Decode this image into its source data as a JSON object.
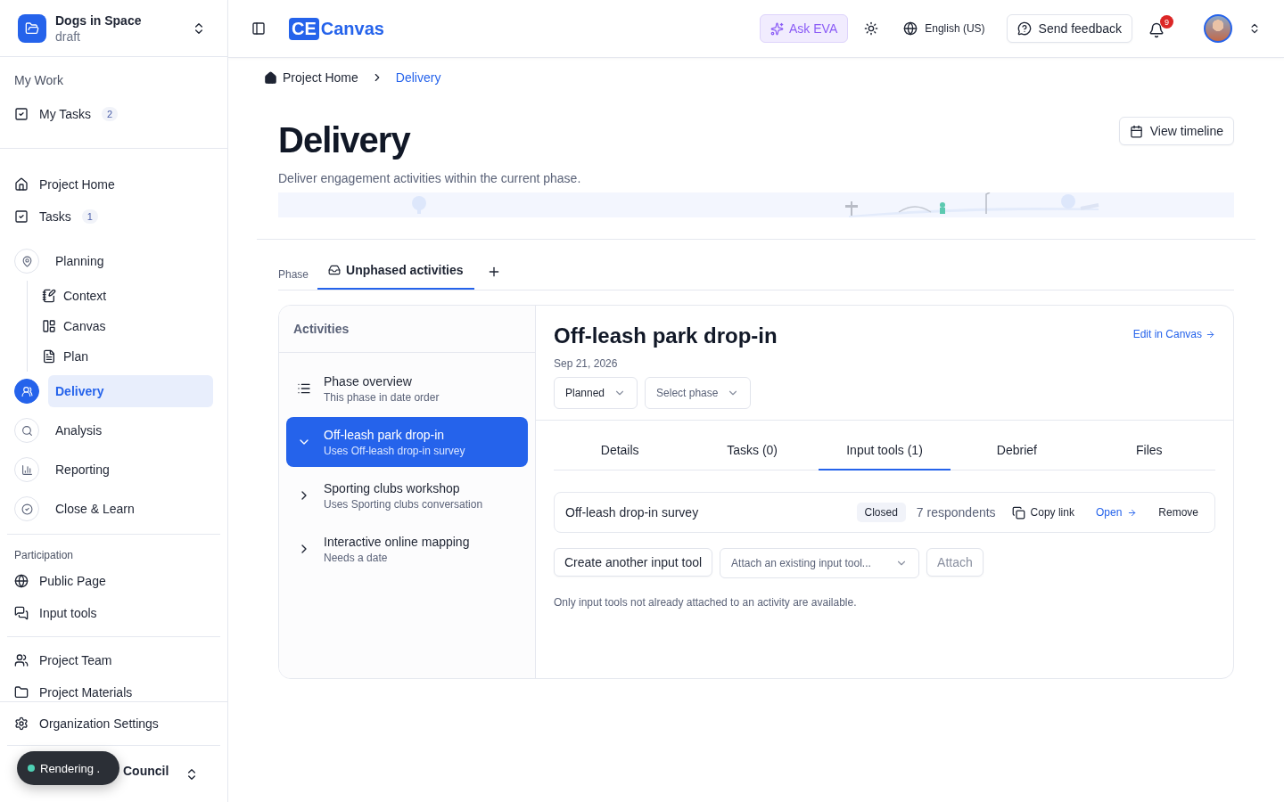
{
  "project": {
    "name": "Dogs in Space",
    "status": "draft"
  },
  "sidebar": {
    "my_work": {
      "heading": "My Work",
      "items": [
        {
          "label": "My Tasks",
          "count": "2"
        }
      ]
    },
    "project_items": [
      {
        "label": "Project Home"
      },
      {
        "label": "Tasks",
        "count": "1"
      }
    ],
    "phases": [
      {
        "label": "Planning",
        "selected": false,
        "children": [
          {
            "label": "Context"
          },
          {
            "label": "Canvas"
          },
          {
            "label": "Plan"
          }
        ]
      },
      {
        "label": "Delivery",
        "selected": true
      },
      {
        "label": "Analysis",
        "selected": false
      },
      {
        "label": "Reporting",
        "selected": false
      },
      {
        "label": "Close & Learn",
        "selected": false
      }
    ],
    "participation": {
      "heading": "Participation",
      "items": [
        {
          "label": "Public Page"
        },
        {
          "label": "Input tools"
        }
      ]
    },
    "team_items": [
      {
        "label": "Project Team"
      },
      {
        "label": "Project Materials"
      }
    ],
    "settings": "Organization Settings",
    "org": {
      "name": "Council"
    }
  },
  "toast": {
    "label": "Rendering ."
  },
  "topbar": {
    "logo_mark": "CE",
    "logo_text": "Canvas",
    "ask": "Ask EVA",
    "language": "English (US)",
    "feedback": "Send feedback",
    "notifications": "9"
  },
  "breadcrumb": [
    "Project Home",
    "Delivery"
  ],
  "page": {
    "title": "Delivery",
    "subtitle": "Deliver engagement activities within the current phase.",
    "timeline_button": "View timeline"
  },
  "phase_tabs": {
    "label": "Phase",
    "tabs": [
      {
        "label": "Unphased activities",
        "selected": true
      }
    ]
  },
  "activities": {
    "heading": "Activities",
    "items": [
      {
        "kind": "overview",
        "title": "Phase overview",
        "subtitle": "This phase in date order",
        "selected": false
      },
      {
        "kind": "activity",
        "title": "Off-leash park drop-in",
        "subtitle": "Uses Off-leash drop-in survey",
        "selected": true,
        "expanded": true
      },
      {
        "kind": "activity",
        "title": "Sporting clubs workshop",
        "subtitle": "Uses Sporting clubs conversation",
        "selected": false,
        "expanded": false
      },
      {
        "kind": "activity",
        "title": "Interactive online mapping",
        "subtitle": "Needs a date",
        "selected": false,
        "expanded": false
      }
    ]
  },
  "detail": {
    "title": "Off-leash park drop-in",
    "date": "Sep 21, 2026",
    "status_select": "Planned",
    "phase_select": {
      "placeholder": "Select phase"
    },
    "edit_link": "Edit in Canvas",
    "tabs": [
      {
        "label": "Details",
        "selected": false
      },
      {
        "label": "Tasks (0)",
        "selected": false
      },
      {
        "label": "Input tools (1)",
        "selected": true
      },
      {
        "label": "Debrief",
        "selected": false
      },
      {
        "label": "Files",
        "selected": false
      }
    ],
    "tool": {
      "name": "Off-leash drop-in survey",
      "status": "Closed",
      "respondents": "7 respondents",
      "copy": "Copy link",
      "open": "Open",
      "remove": "Remove"
    },
    "create_button": "Create another input tool",
    "attach_select": {
      "placeholder": "Attach an existing input tool..."
    },
    "attach_button": {
      "label": "Attach",
      "disabled": true
    },
    "note": "Only input tools not already attached to an activity are available."
  }
}
